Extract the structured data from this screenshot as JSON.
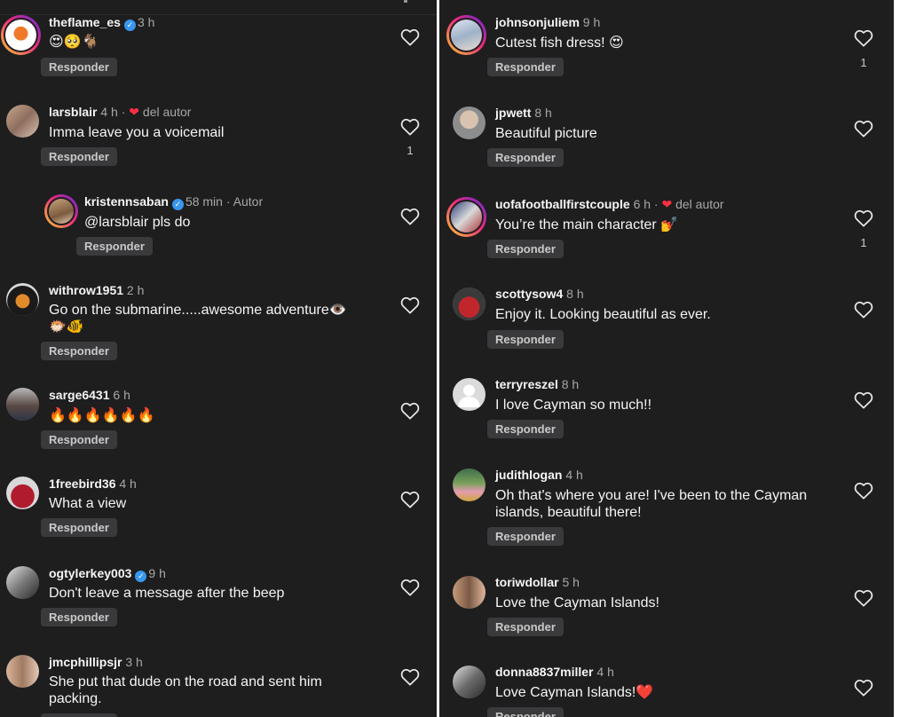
{
  "reply_label": "Responder",
  "colors": {
    "background": "#1e1e1f",
    "button": "#3a3a3c",
    "verified": "#3897f0",
    "author_heart": "#ff3040"
  },
  "left": {
    "comments": [
      {
        "username": "theflame_es",
        "time": "3 h",
        "text": "😍🥺🐐"
      },
      {
        "username": "larsblair",
        "time": "4 h",
        "dot": "·",
        "liked_by": "del autor",
        "text": "Imma leave you a voicemail",
        "likes": "1"
      },
      {
        "username": "kristennsaban",
        "time": "58 min",
        "dot": "·",
        "role": "Autor",
        "text": "@larsblair pls do"
      },
      {
        "username": "withrow1951",
        "time": "2 h",
        "text": "Go on the submarine.....awesome adventure👁️",
        "text2": "🐡🐠"
      },
      {
        "username": "sarge6431",
        "time": "6 h",
        "text": "🔥🔥🔥🔥🔥🔥"
      },
      {
        "username": "1freebird36",
        "time": "4 h",
        "text": "What a view"
      },
      {
        "username": "ogtylerkey003",
        "time": "9 h",
        "text": "Don't leave a message after the beep"
      },
      {
        "username": "jmcphillipsjr",
        "time": "3 h",
        "text": "She put that dude on the road and sent him",
        "text2": "packing."
      }
    ]
  },
  "right": {
    "comments": [
      {
        "username": "johnsonjuliem",
        "time": "9 h",
        "text": "Cutest fish dress! 😍",
        "likes": "1"
      },
      {
        "username": "jpwett",
        "time": "8 h",
        "text": "Beautiful picture"
      },
      {
        "username": "uofafootballfirstcouple",
        "time": "6 h",
        "dot": "·",
        "liked_by": "del autor",
        "text": "You’re the main character 💅",
        "likes": "1"
      },
      {
        "username": "scottysow4",
        "time": "8 h",
        "text": "Enjoy it.  Looking beautiful as ever."
      },
      {
        "username": "terryreszel",
        "time": "8 h",
        "text": "I love Cayman so much!!"
      },
      {
        "username": "judithlogan",
        "time": "4 h",
        "text": "Oh that's where you are! I've been to the Cayman",
        "text2": "islands, beautiful there!"
      },
      {
        "username": "toriwdollar",
        "time": "5 h",
        "text": "Love the Cayman Islands!"
      },
      {
        "username": "donna8837miller",
        "time": "4 h",
        "text": "Love Cayman Islands!❤️"
      }
    ]
  }
}
